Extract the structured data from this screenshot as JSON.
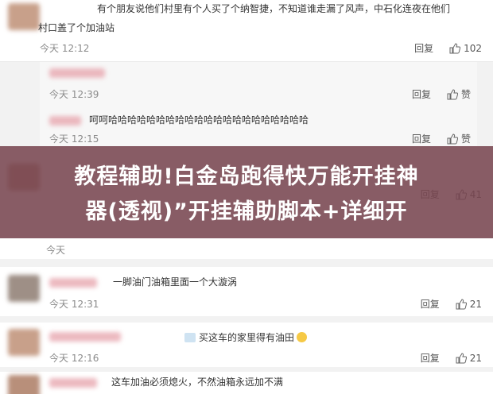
{
  "comments": [
    {
      "text_line1": "有个朋友说他们村里有个人买了个纳智捷，不知道谁走漏了风声，中石化连夜在他们",
      "text_line2": "村口盖了个加油站",
      "time": "今天 12:12",
      "reply": "回复",
      "likes": "102"
    },
    {
      "text": "",
      "time": "今天 12:39",
      "reply": "回复",
      "likes": "赞"
    },
    {
      "text": "呵呵哈哈哈哈哈哈哈哈哈哈哈哈哈哈哈哈哈哈哈哈哈",
      "time": "今天 12:15",
      "reply": "回复",
      "likes": "赞"
    },
    {
      "text": "",
      "time": "今天",
      "reply": "回复",
      "likes": "41"
    },
    {
      "text": "一脚油门油箱里面一个大漩涡",
      "time": "今天 12:31",
      "reply": "回复",
      "likes": "21"
    },
    {
      "text": "买这车的家里得有油田",
      "time": "今天 12:16",
      "reply": "回复",
      "likes": "21"
    },
    {
      "text": "这车加油必须熄火，不然油箱永远加不满"
    }
  ],
  "banner": {
    "line1": "教程辅助!白金岛跑得快万能开挂神",
    "line2": "器(透视)”开挂辅助脚本+详细开"
  },
  "colors": {
    "banner_bg": "#784650",
    "avatar_1": "#c8a08a",
    "avatar_2": "#b88f7a",
    "avatar_3": "#9e8f86",
    "name_blur": "#e8a8b0"
  }
}
